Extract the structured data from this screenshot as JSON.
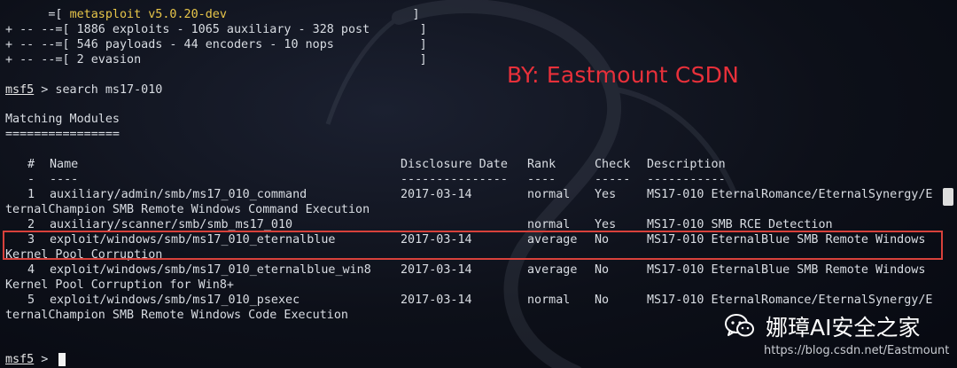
{
  "banner": {
    "line1_prefix": "      =[ ",
    "line1_version": "metasploit v5.0.20-dev",
    "line1_suffix": "                          ]",
    "line2": "+ -- --=[ 1886 exploits - 1065 auxiliary - 328 post       ]",
    "line3": "+ -- --=[ 546 payloads - 44 encoders - 10 nops            ]",
    "line4": "+ -- --=[ 2 evasion                                       ]"
  },
  "prompt": {
    "word": "msf5",
    "command": " > search ms17-010"
  },
  "section": {
    "title": "Matching Modules",
    "underline": "================"
  },
  "table": {
    "headers": {
      "num": "#",
      "name": "Name",
      "date": "Disclosure Date",
      "rank": "Rank",
      "check": "Check",
      "desc": "Description"
    },
    "dashes": {
      "num": "-",
      "name": "----",
      "date": "---------------",
      "rank": "----",
      "check": "-----",
      "desc": "-----------"
    },
    "rows": [
      {
        "num": "1",
        "name": "auxiliary/admin/smb/ms17_010_command",
        "date": "2017-03-14",
        "rank": "normal",
        "check": "Yes",
        "desc": "MS17-010 EternalRomance/EternalSynergy/E",
        "wrap": "ternalChampion SMB Remote Windows Command Execution"
      },
      {
        "num": "2",
        "name": "auxiliary/scanner/smb/smb_ms17_010",
        "date": "",
        "rank": "normal",
        "check": "Yes",
        "desc": "MS17-010 SMB RCE Detection",
        "wrap": ""
      },
      {
        "num": "3",
        "name": "exploit/windows/smb/ms17_010_eternalblue",
        "date": "2017-03-14",
        "rank": "average",
        "check": "No",
        "desc": "MS17-010 EternalBlue SMB Remote Windows",
        "wrap": "Kernel Pool Corruption"
      },
      {
        "num": "4",
        "name": "exploit/windows/smb/ms17_010_eternalblue_win8",
        "date": "2017-03-14",
        "rank": "average",
        "check": "No",
        "desc": "MS17-010 EternalBlue SMB Remote Windows",
        "wrap": "Kernel Pool Corruption for Win8+"
      },
      {
        "num": "5",
        "name": "exploit/windows/smb/ms17_010_psexec",
        "date": "2017-03-14",
        "rank": "normal",
        "check": "No",
        "desc": "MS17-010 EternalRomance/EternalSynergy/E",
        "wrap": "ternalChampion SMB Remote Windows Code Execution"
      }
    ]
  },
  "final_prompt": {
    "word": "msf5",
    "suffix": " > "
  },
  "watermark": "BY:  Eastmount CSDN",
  "wechat": {
    "icon": "wechat-icon",
    "account": "娜璋AI安全之家"
  },
  "url": "https://blog.csdn.net/Eastmount",
  "colors": {
    "accent_yellow": "#e8c64a",
    "watermark_red": "#e8303a",
    "highlight_border": "#d8413b"
  }
}
